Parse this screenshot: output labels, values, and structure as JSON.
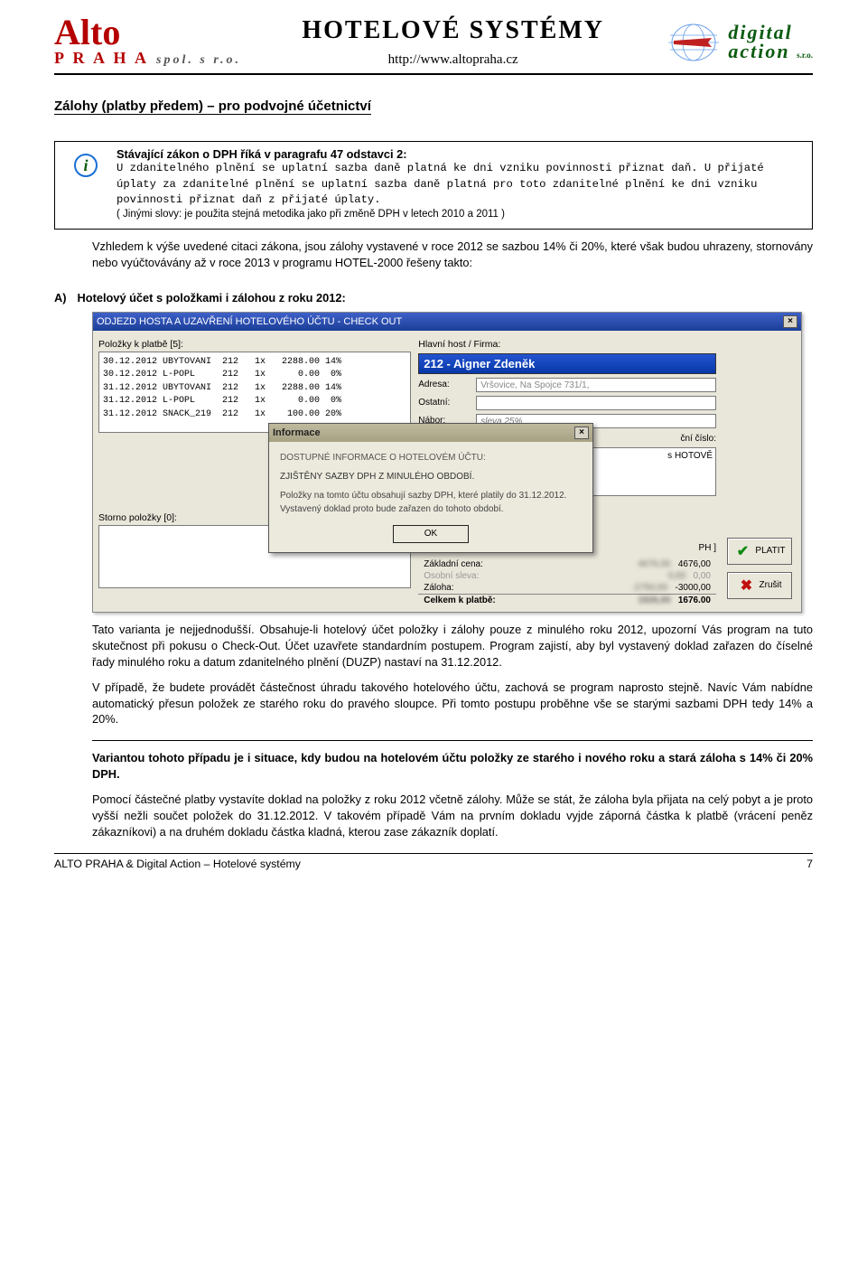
{
  "header": {
    "logo_left": {
      "line1": "Alto",
      "line2": "P R A H A",
      "small": "spol. s r.o."
    },
    "center_title": "HOTELOVÉ  SYSTÉMY",
    "center_url": "http://www.altopraha.cz",
    "logo_right": {
      "line1": "digital",
      "line2": "action",
      "small": "s.r.o."
    }
  },
  "heading": "Zálohy (platby předem) – pro podvojné účetnictví",
  "info": {
    "bold_intro": "Stávající zákon o DPH říká v paragrafu 47 odstavci 2:",
    "tt1": "U zdanitelného plnění se uplatní sazba daně platná ke dni vzniku povinnosti přiznat daň. U přijaté úplaty za zdanitelné plnění se uplatní sazba daně platná pro toto zdanitelné plnění ke dni vzniku povinnosti přiznat daň z přijaté úplaty.",
    "note": "( Jinými slovy:  je použita stejná metodika jako při změně DPH v letech 2010 a 2011 )"
  },
  "para1": "Vzhledem k výše uvedené citaci zákona, jsou zálohy vystavené v roce 2012 se sazbou 14% či 20%, které však budou uhrazeny, stornovány nebo vyúčtovávány až v roce 2013 v programu HOTEL-2000 řešeny takto:",
  "section_A": {
    "letter": "A)",
    "title": "Hotelový účet s položkami i zálohou z roku 2012:"
  },
  "shot": {
    "title": "ODJEZD HOSTA A UZAVŘENÍ HOTELOVÉHO ÚČTU  -  CHECK OUT",
    "left": {
      "label_items": "Položky k platbě [5]:",
      "rows": [
        "30.12.2012 UBYTOVANI  212   1x   2288.00 14%",
        "30.12.2012 L-POPL     212   1x      0.00  0%",
        "31.12.2012 UBYTOVANI  212   1x   2288.00 14%",
        "31.12.2012 L-POPL     212   1x      0.00  0%",
        "31.12.2012 SNACK_219  212   1x    100.00 20%"
      ],
      "storno_label": "Storno položky [0]:"
    },
    "right": {
      "label_host": "Hlavní host / Firma:",
      "host_value": "212 - Aigner Zdeněk",
      "addr_label": "Adresa:",
      "addr_value": "Vršovice, Na Spojce 731/1,",
      "ostatni_label": "Ostatní:",
      "nabor_label": "Nábor:",
      "nabor_value": "sleva 25%",
      "cutoff1": "ční číslo:",
      "cutoff2": "s HOTOVĚ",
      "cutoff3": "PH ]",
      "totals": {
        "base_label": "Základní cena:",
        "base_value": "4676,00",
        "discount_label": "Osobní sleva:",
        "discount_value": "0,00",
        "deposit_label": "Záloha:",
        "deposit_value": "-3000,00",
        "sum_label": "Celkem k platbě:",
        "sum_value": "1676.00"
      }
    },
    "buttons": {
      "pay": "PLATIT",
      "cancel": "Zrušit"
    },
    "popup": {
      "title": "Informace",
      "hd": "DOSTUPNÉ INFORMACE O HOTELOVÉM ÚČTU:",
      "sub": "ZJIŠTĚNY SAZBY DPH Z MINULÉHO OBDOBÍ.",
      "body1": "Položky na tomto účtu obsahují sazby DPH, které platily do 31.12.2012.",
      "body2": "Vystavený doklad proto bude zařazen do tohoto období.",
      "ok": "OK"
    }
  },
  "para2": "Tato varianta je nejjednodušší. Obsahuje-li hotelový účet položky i zálohy pouze  z minulého roku 2012, upozorní Vás program na tuto skutečnost při pokusu o Check-Out. Účet uzavřete standardním postupem. Program zajistí, aby byl vystavený doklad zařazen do číselné řady minulého roku a datum zdanitelného plnění (DUZP) nastaví na 31.12.2012.",
  "para3": "V případě, že budete provádět částečnost úhradu takového hotelového účtu, zachová se program naprosto stejně. Navíc Vám nabídne automatický přesun položek ze starého roku do pravého sloupce. Při tomto postupu proběhne vše se starými sazbami DPH tedy 14% a 20%.",
  "para4_bold": "Variantou tohoto případu je i situace, kdy budou na hotelovém účtu položky ze starého i nového roku a stará záloha s 14% či 20% DPH.",
  "para5": "Pomocí částečné platby vystavíte doklad na položky z roku 2012 včetně zálohy. Může se stát, že záloha byla přijata na celý pobyt a je proto vyšší nežli součet položek do 31.12.2012. V takovém případě Vám na prvním dokladu vyjde záporná částka k platbě (vrácení peněz zákazníkovi) a na druhém dokladu částka kladná, kterou zase zákazník doplatí.",
  "footer": {
    "left": "ALTO PRAHA & Digital Action – Hotelové systémy",
    "right": "7"
  }
}
